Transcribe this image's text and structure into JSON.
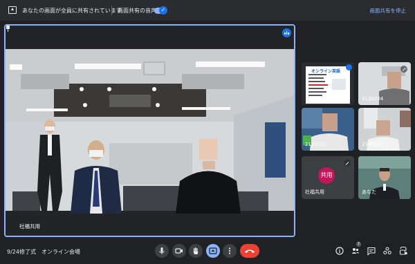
{
  "share_bar": {
    "status_text": "あなたの画面が全員に共有されています",
    "audio_label": "画面共有の音声",
    "audio_enabled": true,
    "stop_button": "画面共有を停止"
  },
  "main_tile": {
    "name": "社福共用",
    "speaking": true
  },
  "thumbnails": [
    {
      "id": "slide",
      "name": "",
      "muted": false,
      "speaking": true,
      "slide_title": "オンライン英語"
    },
    {
      "id": "p1",
      "name": "2130204",
      "muted": true
    },
    {
      "id": "p2",
      "name": "2130132",
      "muted": false
    },
    {
      "id": "p3",
      "name": "2130042",
      "muted": false
    },
    {
      "id": "shared",
      "name": "社福共用",
      "avatar_text": "共用",
      "avatar_color": "#c2185b",
      "muted": true
    },
    {
      "id": "you",
      "name": "あなた",
      "muted": false
    }
  ],
  "footer": {
    "meeting_title": "9/24修了式　オンライン会場",
    "participant_count": "7",
    "controls": [
      "mic",
      "camera",
      "raise-hand",
      "present",
      "more",
      "leave"
    ],
    "right_controls": [
      "info",
      "people",
      "chat",
      "activities",
      "host-controls"
    ]
  },
  "colors": {
    "accent": "#8ab4f8",
    "speaking": "#1a73e8",
    "end_call": "#ea4335",
    "background": "#202124"
  }
}
